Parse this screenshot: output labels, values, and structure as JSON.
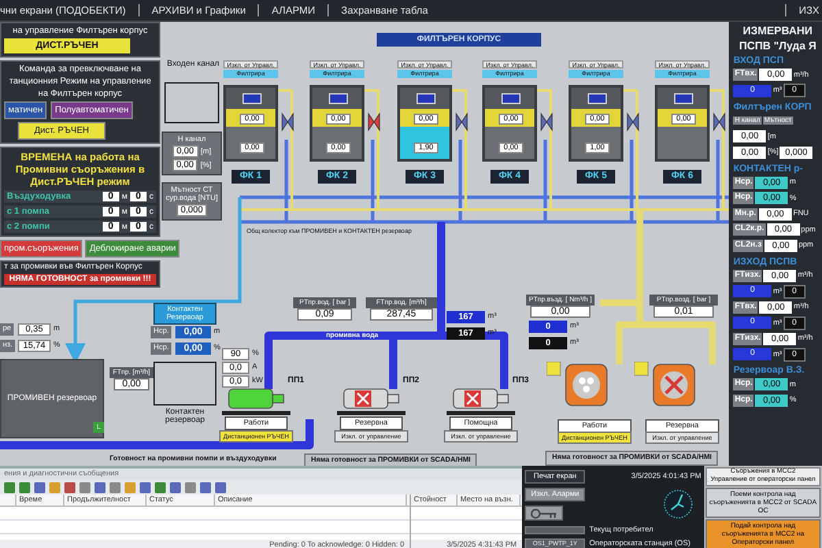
{
  "menu": {
    "items": [
      {
        "label": "чни екрани (ПОДОБЕКТИ)"
      },
      {
        "label": "АРХИВИ и Графики"
      },
      {
        "label": "АЛАРМИ"
      },
      {
        "label": "Захранване табла"
      }
    ],
    "right_item": "ИЗХ"
  },
  "control_panel": {
    "title": "на управление Филтърен корпус",
    "mode": "ДИСТ.РЪЧЕН",
    "command_lines": [
      "Команда за превключване на",
      "танционния Режим на управление",
      "на Филтърен корпус"
    ],
    "mode_buttons": [
      {
        "label": "матичен",
        "kind": "auto"
      },
      {
        "label": "Полуавтоматичен",
        "kind": "semi"
      },
      {
        "label": "Дист. РЪЧЕН",
        "kind": "manual"
      }
    ],
    "times_title": "ВРЕМЕНА на работа на Промивни съоръжения в Дист.РЪЧЕН режим",
    "times": [
      {
        "label": "Въздуходувка",
        "minutes": "0",
        "min_unit": "м",
        "seconds": "0",
        "sec_unit": "с"
      },
      {
        "label": "с 1 помпа",
        "minutes": "0",
        "min_unit": "м",
        "seconds": "0",
        "sec_unit": "с"
      },
      {
        "label": "с 2 помпи",
        "minutes": "0",
        "min_unit": "м",
        "seconds": "0",
        "sec_unit": "с"
      }
    ],
    "actions": [
      {
        "label": "пром.съоръжения",
        "kind": "danger"
      },
      {
        "label": "Деблокиране аварии",
        "kind": "reset"
      }
    ],
    "readiness_title": "т за промивки във Филтърен Корпус",
    "readiness_message": "НЯМА ГОТОВНОСТ за промивки !!!"
  },
  "filter_house": {
    "title": "ФИЛТЪРЕН КОРПУС",
    "filters": [
      {
        "name": "ФК 1",
        "control": "Изкл. от Управл.",
        "status": "Филтрира",
        "upper": "0,00",
        "lower": "0,00",
        "flushing": false,
        "valve_fault": false
      },
      {
        "name": "ФК 2",
        "control": "Изкл. от Управл.",
        "status": "Филтрира",
        "upper": "0,00",
        "lower": "0,00",
        "flushing": false,
        "valve_fault": true
      },
      {
        "name": "ФК 3",
        "control": "Изкл. от Управл.",
        "status": "Филтрира",
        "upper": "0,00",
        "lower": "1,90",
        "flushing": true,
        "valve_fault": false
      },
      {
        "name": "ФК 4",
        "control": "Изкл. от Управл.",
        "status": "Филтрира",
        "upper": "0,00",
        "lower": "0,00",
        "flushing": false,
        "valve_fault": false
      },
      {
        "name": "ФК 5",
        "control": "Изкл. от Управл.",
        "status": "Филтрира",
        "upper": "0,00",
        "lower": "1,00",
        "flushing": false,
        "valve_fault": false
      },
      {
        "name": "ФК 6",
        "control": "Изкл. от Управл.",
        "status": "Филтрира",
        "upper": "0,00",
        "flushing": false,
        "valve_fault": false
      }
    ]
  },
  "inlet": {
    "title": "Входен канал",
    "h_label": "Н канал",
    "h_value": "0,00",
    "h_unit": "[m]",
    "pct_value": "0,00",
    "pct_unit": "[%]",
    "turbidity_label": "Мътност СТ сур.вода [NTU]",
    "turbidity_value": "0,000"
  },
  "collector_note": "Общ колектор към ПРОМИВЕН и КОНТАКТЕН резервоар",
  "gauges": [
    {
      "label": "PTпр.вод. [ bar ]",
      "value": "0,09"
    },
    {
      "label": "FTпр.вод. [m³/h]",
      "value": "287,45"
    },
    {
      "label": "PTпр.възд. [ Nm³/h ]",
      "value": "0,00"
    },
    {
      "label": "PTпр.возд. [ bar ]",
      "value": "0,01"
    },
    {
      "label": "FTпр. [m³/h]",
      "value": "0,00"
    }
  ],
  "totals": [
    {
      "value": "167",
      "unit": "m³",
      "kind": "current"
    },
    {
      "value": "167",
      "unit": "m³",
      "kind": "total"
    },
    {
      "value": "0",
      "unit": "m³",
      "kind": "current"
    },
    {
      "value": "0",
      "unit": "m³",
      "kind": "total"
    }
  ],
  "pipe_label": "промивна вода",
  "contact_reservoir": {
    "title": "Контактен Резервоар",
    "readings": [
      {
        "label": "Нср.",
        "value": "0,00",
        "unit": "m"
      },
      {
        "label": "Нср.",
        "value": "0,00",
        "unit": "%"
      }
    ],
    "name": "Контактен резервоар"
  },
  "flush_reservoir": {
    "name": "ПРОМИВЕН резервоар",
    "readings": [
      {
        "label": "ре",
        "value": "0,35",
        "unit": "m"
      },
      {
        "label": "нз.",
        "value": "15,74",
        "unit": "%"
      }
    ],
    "low_level": "L"
  },
  "pump_readings": [
    {
      "value": "90",
      "unit": "%"
    },
    {
      "value": "0,0",
      "unit": "A"
    },
    {
      "value": "0,0",
      "unit": "kW"
    }
  ],
  "pumps": [
    {
      "name": "ПП1",
      "running": true,
      "status": "Работи",
      "mode": "Дистанционен РЪЧЕН",
      "remote": true
    },
    {
      "name": "ПП2",
      "running": false,
      "status": "Резервна",
      "mode": "Изкл. от управление",
      "remote": false
    },
    {
      "name": "ПП3",
      "running": false,
      "status": "Помощна",
      "mode": "Изкл. от управление",
      "remote": false
    }
  ],
  "blowers": [
    {
      "running": true,
      "status": "Работи",
      "mode": "Дистанционен РЪЧЕН",
      "remote": true
    },
    {
      "running": false,
      "status": "Резервна",
      "mode": "Изкл. от управление",
      "remote": false
    }
  ],
  "status_texts": [
    {
      "text": "Готовност на промивни помпи и въздуходувки",
      "kind": "label"
    },
    {
      "text": "Няма готовност за ПРОМИВКИ от SCADA/HMI",
      "kind": "box"
    },
    {
      "text": "Няма готовност за ПРОМИВКИ от SCADA/HMI",
      "kind": "box"
    }
  ],
  "measurements": {
    "rows": [
      {
        "kind": "title",
        "text": "ИЗМЕРВАНИ"
      },
      {
        "kind": "title",
        "text": "ПСПВ \"Луда Я"
      },
      {
        "kind": "section",
        "text": "ВХОД ПСП"
      },
      {
        "kind": "measure",
        "label": "FTвх.",
        "value": "0,00",
        "unit": "m³/h"
      },
      {
        "kind": "counter",
        "value": "0",
        "unit": "m³",
        "total": "0"
      },
      {
        "kind": "section",
        "text": "Филтърен КОРП"
      },
      {
        "kind": "columns",
        "items": [
          "Н канал",
          "Мътност"
        ]
      },
      {
        "kind": "field",
        "value": "0,00",
        "unit": "[m"
      },
      {
        "kind": "field",
        "value": "0,00",
        "unit": "[%]",
        "value2": "0,000"
      },
      {
        "kind": "section",
        "text": "КОНТАКТЕН р-"
      },
      {
        "kind": "level",
        "label": "Нср.",
        "value": "0,00",
        "unit": "m"
      },
      {
        "kind": "level",
        "label": "Нср.",
        "value": "0,00",
        "unit": "%"
      },
      {
        "kind": "measure",
        "label": "Мн.р.",
        "value": "0,00",
        "unit": "FNU"
      },
      {
        "kind": "measure",
        "label": "CL2к.р.",
        "value": "0,00",
        "unit": "ppm"
      },
      {
        "kind": "measure",
        "label": "CL2н.з",
        "value": "0,00",
        "unit": "ppm"
      },
      {
        "kind": "section",
        "text": "ИЗХОД ПСПВ"
      },
      {
        "kind": "measure",
        "label": "FTизх.",
        "value": "0,00",
        "unit": "m³/h"
      },
      {
        "kind": "counter",
        "value": "0",
        "unit": "m³",
        "total": "0"
      },
      {
        "kind": "measure",
        "label": "FTвх.",
        "value": "0,00",
        "unit": "m³/h"
      },
      {
        "kind": "counter",
        "value": "0",
        "unit": "m³",
        "total": "0"
      },
      {
        "kind": "measure",
        "label": "FTизх.",
        "value": "0,00",
        "unit": "m³/h"
      },
      {
        "kind": "counter",
        "value": "0",
        "unit": "m³",
        "total": "0"
      },
      {
        "kind": "section",
        "text": "Резервоар В.З."
      },
      {
        "kind": "level",
        "label": "Нср.",
        "value": "0,00",
        "unit": "m"
      },
      {
        "kind": "level",
        "label": "Нср.",
        "value": "0,00",
        "unit": "%"
      }
    ]
  },
  "alarm_list": {
    "title": "ения и диагностични съобщения",
    "columns": [
      "Време",
      "Продължителност",
      "Статус",
      "Описание"
    ],
    "side_columns": [
      "Стойност",
      "Место на възн."
    ],
    "footer": "Pending: 0   To acknowledge: 0   Hidden: 0",
    "timestamp": "3/5/2025 4:31:43 PM"
  },
  "operator_panel": {
    "print_button": "Печат екран",
    "alarms_button": "Изкл. Аларми",
    "datetime": "3/5/2025 4:01:43 PM",
    "user_label": "Текущ потребител",
    "station_value": "OS1_PWTP_1Y",
    "station_label": "Операторската станция (OS)"
  },
  "handover": [
    {
      "kind": "status",
      "title": "Съоръжения в МСС2",
      "text": "Управление от операторски панел"
    },
    {
      "kind": "take",
      "text": "Поеми контрола над съоръженията в МСС2 от SCADA OC"
    },
    {
      "kind": "give",
      "text": "Подай контрола над съоръженията в МСС2 на Операторски панел"
    }
  ]
}
